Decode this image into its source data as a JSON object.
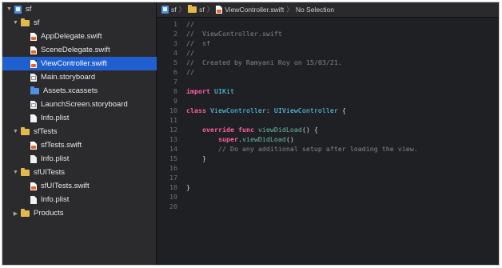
{
  "navigator": {
    "items": [
      {
        "label": "sf",
        "icon": "project-icon",
        "depth": 0,
        "disclosure": "open"
      },
      {
        "label": "sf",
        "icon": "folder-icon",
        "depth": 1,
        "disclosure": "open"
      },
      {
        "label": "AppDelegate.swift",
        "icon": "swift-file-icon",
        "depth": 2
      },
      {
        "label": "SceneDelegate.swift",
        "icon": "swift-file-icon",
        "depth": 2
      },
      {
        "label": "ViewController.swift",
        "icon": "swift-file-icon",
        "depth": 2,
        "selected": true
      },
      {
        "label": "Main.storyboard",
        "icon": "storyboard-file-icon",
        "depth": 2
      },
      {
        "label": "Assets.xcassets",
        "icon": "asset-catalog-icon",
        "depth": 2
      },
      {
        "label": "LaunchScreen.storyboard",
        "icon": "storyboard-file-icon",
        "depth": 2
      },
      {
        "label": "Info.plist",
        "icon": "plist-file-icon",
        "depth": 2
      },
      {
        "label": "sfTests",
        "icon": "folder-icon",
        "depth": 1,
        "disclosure": "open"
      },
      {
        "label": "sfTests.swift",
        "icon": "swift-file-icon",
        "depth": 2
      },
      {
        "label": "Info.plist",
        "icon": "plist-file-icon",
        "depth": 2
      },
      {
        "label": "sfUITests",
        "icon": "folder-icon",
        "depth": 1,
        "disclosure": "open"
      },
      {
        "label": "sfUITests.swift",
        "icon": "swift-file-icon",
        "depth": 2
      },
      {
        "label": "Info.plist",
        "icon": "plist-file-icon",
        "depth": 2
      },
      {
        "label": "Products",
        "icon": "folder-icon",
        "depth": 1,
        "disclosure": "closed"
      }
    ]
  },
  "jumpbar": {
    "project": "sf",
    "group": "sf",
    "file": "ViewController.swift",
    "selection": "No Selection"
  },
  "editor": {
    "lines": [
      {
        "n": "1",
        "text": "//"
      },
      {
        "n": "2",
        "text": "//  ViewController.swift"
      },
      {
        "n": "3",
        "text": "//  sf"
      },
      {
        "n": "4",
        "text": "//"
      },
      {
        "n": "5",
        "text": "//  Created by Ramyani Roy on 15/03/21."
      },
      {
        "n": "6",
        "text": "//"
      },
      {
        "n": "7",
        "text": ""
      },
      {
        "n": "8",
        "text": "import UIKit"
      },
      {
        "n": "9",
        "text": ""
      },
      {
        "n": "10",
        "text": "class ViewController: UIViewController {"
      },
      {
        "n": "11",
        "text": ""
      },
      {
        "n": "12",
        "text": "    override func viewDidLoad() {"
      },
      {
        "n": "13",
        "text": "        super.viewDidLoad()"
      },
      {
        "n": "14",
        "text": "        // Do any additional setup after loading the view."
      },
      {
        "n": "15",
        "text": "    }"
      },
      {
        "n": "16",
        "text": ""
      },
      {
        "n": "17",
        "text": ""
      },
      {
        "n": "18",
        "text": "}"
      },
      {
        "n": "19",
        "text": ""
      },
      {
        "n": "20",
        "text": ""
      }
    ]
  },
  "colors": {
    "selection": "#1f5fcf",
    "keyword": "#fc5fa3",
    "type": "#5dd8ff",
    "function": "#67b7a4",
    "comment": "#7b8790",
    "folder": "#e4b84a"
  }
}
